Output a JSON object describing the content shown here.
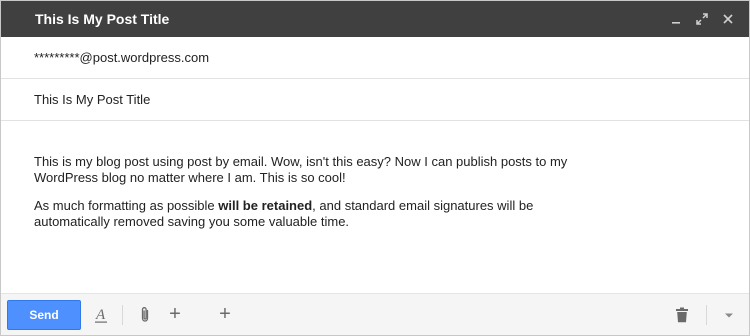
{
  "window": {
    "title": "This Is My Post Title",
    "controls": [
      "minimize-icon",
      "expand-icon",
      "close-icon"
    ]
  },
  "fields": {
    "to_value": "*********@post.wordpress.com",
    "subject_value": "This Is My Post Title"
  },
  "body": {
    "paragraph1": "This is my blog post using post by email. Wow, isn't this easy? Now I can publish posts to my WordPress blog no matter where I am. This is so cool!",
    "paragraph2_before": "As much formatting as possible ",
    "paragraph2_bold": "will be retained",
    "paragraph2_after": ", and standard email signatures will be automatically removed saving you some valuable time."
  },
  "toolbar": {
    "send_label": "Send",
    "format_icon_glyph": "A",
    "attach_plus_glyph": "+",
    "insert_plus_glyph": "+"
  },
  "colors": {
    "titlebar": "#404040",
    "send_button": "#4d90fe",
    "toolbar_bg": "#f5f5f5"
  }
}
